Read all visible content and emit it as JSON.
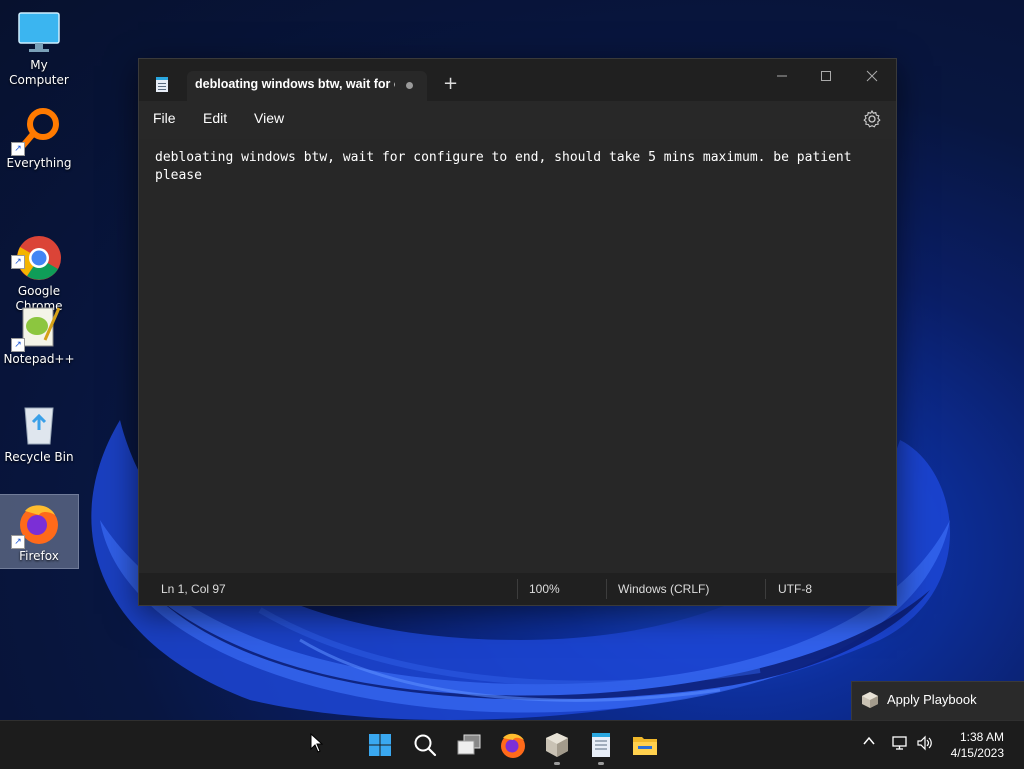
{
  "desktop": {
    "icons": [
      {
        "label": "My Computer"
      },
      {
        "label": "Everything"
      },
      {
        "label": "Google\nChrome"
      },
      {
        "label": "Notepad++"
      },
      {
        "label": "Recycle Bin"
      },
      {
        "label": "Firefox",
        "selected": true
      }
    ]
  },
  "notepad": {
    "tab_title": "debloating windows btw, wait for c",
    "new_tab_symbol": "+",
    "menu": {
      "file": "File",
      "edit": "Edit",
      "view": "View"
    },
    "content": "debloating windows btw, wait for configure to end, should take 5 mins maximum. be patient please",
    "status": {
      "position": "Ln 1, Col 97",
      "zoom": "100%",
      "line_ending": "Windows (CRLF)",
      "encoding": "UTF-8"
    }
  },
  "toast": {
    "label": "Apply Playbook"
  },
  "taskbar": {
    "apps": [
      "start-icon",
      "search-icon",
      "task-view-icon",
      "firefox-icon",
      "playbook-icon",
      "notepad-icon",
      "file-explorer-icon"
    ],
    "clock": {
      "time": "1:38 AM",
      "date": "4/15/2023"
    }
  },
  "colors": {
    "window_bg": "#202020",
    "editor_bg": "#272727",
    "taskbar_bg": "#1c1c1c",
    "accent": "#2aa7e0"
  }
}
